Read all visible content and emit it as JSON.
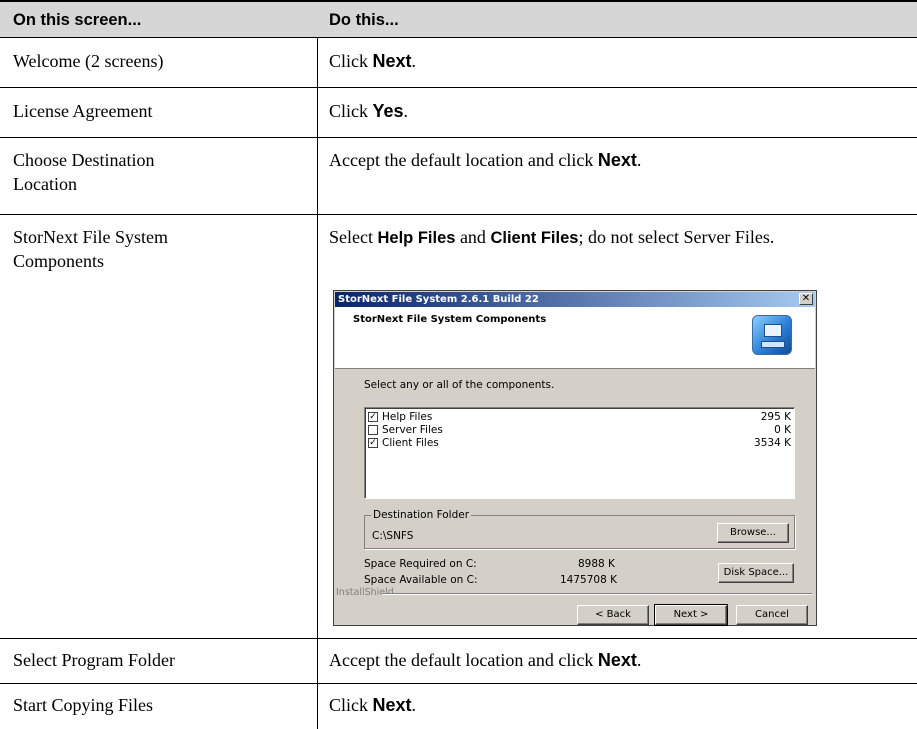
{
  "header": {
    "col1": "On this screen...",
    "col2": "Do this..."
  },
  "rows": [
    {
      "screen": "Welcome (2 screens)",
      "pre": "Click ",
      "b1": "Next",
      "post": "."
    },
    {
      "screen": "License Agreement",
      "pre": "Click ",
      "b1": "Yes",
      "post": "."
    },
    {
      "screen_l1": "Choose Destination",
      "screen_l2": "Location",
      "pre": "Accept the default location and click ",
      "b1": "Next",
      "post": "."
    },
    {
      "screen_l1": "StorNext File System",
      "screen_l2": "Components",
      "pre": "Select ",
      "b1": "Help Files",
      "mid": " and ",
      "b2": "Client Files",
      "post": "; do not select Server Files."
    },
    {
      "screen": "Select Program Folder",
      "pre": "Accept the default location and click ",
      "b1": "Next",
      "post": "."
    },
    {
      "screen": "Start Copying Files",
      "pre": "Click ",
      "b1": "Next",
      "post": "."
    }
  ],
  "dialog": {
    "title": "StorNext File System 2.6.1 Build 22",
    "close_glyph": "✕",
    "banner_title": "StorNext File System Components",
    "prompt": "Select any or all of the components.",
    "components": [
      {
        "name": "Help Files",
        "size": "295 K",
        "check": "✓"
      },
      {
        "name": "Server Files",
        "size": "0 K",
        "check": ""
      },
      {
        "name": "Client Files",
        "size": "3534 K",
        "check": "✓"
      }
    ],
    "dest_legend": "Destination Folder",
    "dest_path": "C:\\SNFS",
    "browse_label": "Browse...",
    "space_required_label": "Space Required on C:",
    "space_required_value": "8988 K",
    "space_available_label": "Space Available on C:",
    "space_available_value": "1475708 K",
    "disk_space_label": "Disk Space...",
    "installshield": "InstallShield",
    "back_label": "< Back",
    "next_label": "Next >",
    "cancel_label": "Cancel"
  }
}
